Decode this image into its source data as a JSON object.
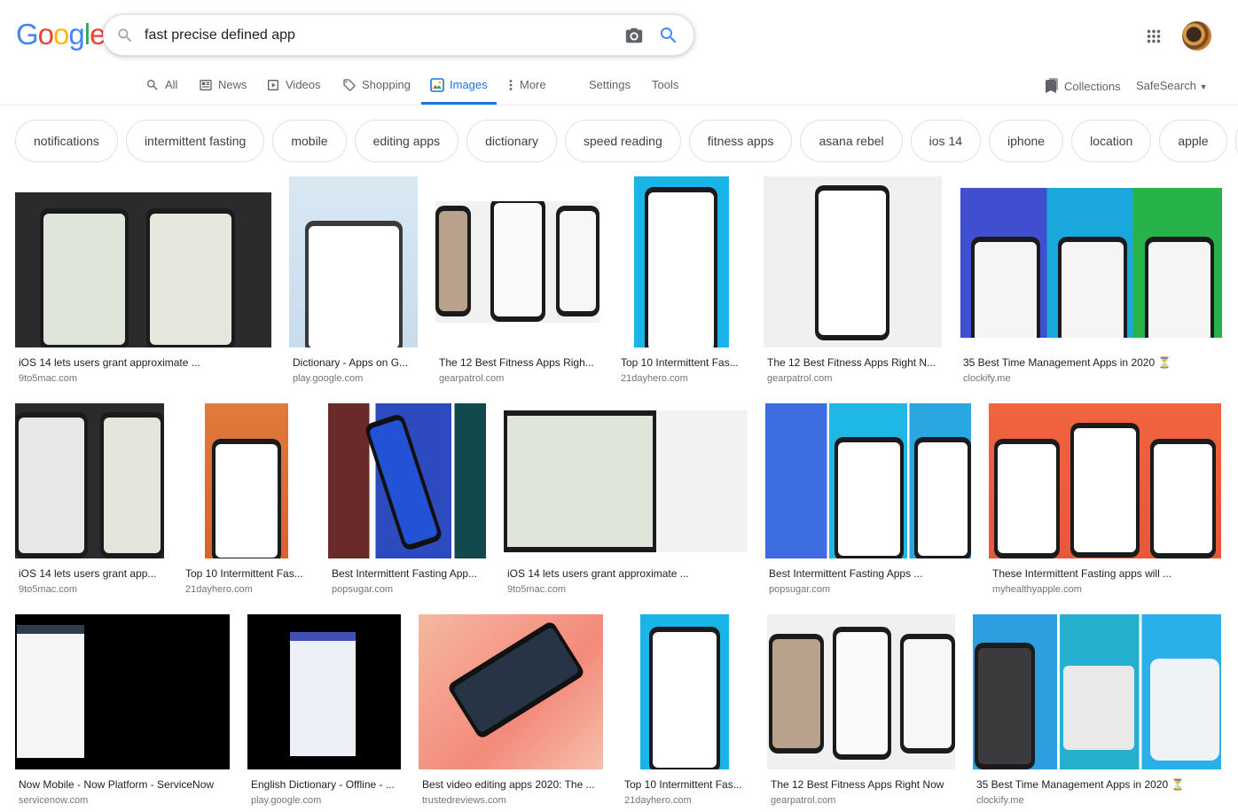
{
  "logo": {
    "letters": [
      "G",
      "o",
      "o",
      "g",
      "l",
      "e"
    ],
    "colors": [
      "#4285F4",
      "#EA4335",
      "#FBBC05",
      "#4285F4",
      "#34A853",
      "#EA4335"
    ]
  },
  "search": {
    "query": "fast precise defined app"
  },
  "tabs": [
    {
      "label": "All",
      "icon": "search-icon"
    },
    {
      "label": "News",
      "icon": "news-icon"
    },
    {
      "label": "Videos",
      "icon": "play-icon"
    },
    {
      "label": "Shopping",
      "icon": "tag-icon"
    },
    {
      "label": "Images",
      "icon": "image-icon",
      "active": true
    },
    {
      "label": "More",
      "icon": "more-vert-icon"
    }
  ],
  "tools": {
    "settings": "Settings",
    "tools": "Tools",
    "collections": "Collections",
    "safesearch": "SafeSearch"
  },
  "chips": [
    "notifications",
    "intermittent fasting",
    "mobile",
    "editing apps",
    "dictionary",
    "speed reading",
    "fitness apps",
    "asana rebel",
    "ios 14",
    "iphone",
    "location",
    "apple"
  ],
  "results": [
    {
      "title": "iOS 14 lets users grant approximate ...",
      "source": "9to5mac.com"
    },
    {
      "title": "Dictionary - Apps on G...",
      "source": "play.google.com"
    },
    {
      "title": "The 12 Best Fitness Apps Righ...",
      "source": "gearpatrol.com"
    },
    {
      "title": "Top 10 Intermittent Fas...",
      "source": "21dayhero.com"
    },
    {
      "title": "The 12 Best Fitness Apps Right N...",
      "source": "gearpatrol.com"
    },
    {
      "title": "35 Best Time Management Apps in 2020 ⏳",
      "source": "clockify.me"
    },
    {
      "title": "iOS 14 lets users grant app...",
      "source": "9to5mac.com"
    },
    {
      "title": "Top 10 Intermittent Fas...",
      "source": "21dayhero.com"
    },
    {
      "title": "Best Intermittent Fasting App...",
      "source": "popsugar.com"
    },
    {
      "title": "iOS 14 lets users grant approximate ...",
      "source": "9to5mac.com"
    },
    {
      "title": "Best Intermittent Fasting Apps ...",
      "source": "popsugar.com"
    },
    {
      "title": "These Intermittent Fasting apps will ...",
      "source": "myhealthyapple.com"
    },
    {
      "title": "Now Mobile - Now Platform - ServiceNow",
      "source": "servicenow.com"
    },
    {
      "title": "English Dictionary - Offline - ...",
      "source": "play.google.com"
    },
    {
      "title": "Best video editing apps 2020: The ...",
      "source": "trustedreviews.com"
    },
    {
      "title": "Top 10 Intermittent Fas...",
      "source": "21dayhero.com"
    },
    {
      "title": "The 12 Best Fitness Apps Right Now",
      "source": "gearpatrol.com"
    },
    {
      "title": "35 Best Time Management Apps in 2020 ⏳",
      "source": "clockify.me"
    }
  ]
}
